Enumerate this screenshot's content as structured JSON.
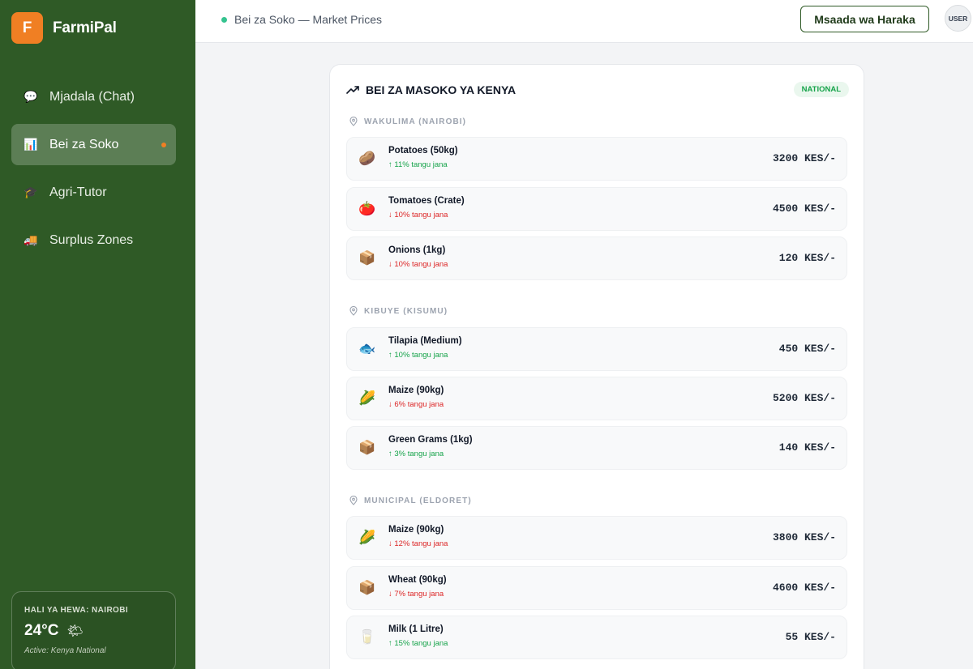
{
  "brand": {
    "logo_letter": "F",
    "name": "FarmiPal",
    "logo_color": "#f07f23"
  },
  "sidebar": {
    "items": [
      {
        "label": "Mjadala (Chat)",
        "icon": "chat-bubble-icon",
        "glyph": "💬",
        "active": false
      },
      {
        "label": "Bei za Soko",
        "icon": "bar-chart-icon",
        "glyph": "📊",
        "active": true
      },
      {
        "label": "Agri-Tutor",
        "icon": "graduation-cap-icon",
        "glyph": "🎓",
        "active": false
      },
      {
        "label": "Surplus Zones",
        "icon": "truck-icon",
        "glyph": "🚚",
        "active": false
      }
    ],
    "bg_color": "#2f5a26"
  },
  "weather": {
    "title": "HALI YA HEWA: NAIROBI",
    "temp": "24°C",
    "icon": "sun-behind-cloud-icon",
    "glyph": "🌤",
    "active_text": "Active: Kenya National"
  },
  "header": {
    "breadcrumb": "Bei za Soko — Market Prices",
    "help_button": "Msaada wa Haraka",
    "user_label": "USER"
  },
  "market": {
    "title": "BEI ZA MASOKO YA KENYA",
    "badge": "NATIONAL",
    "sections": [
      {
        "label": "WAKULIMA (NAIROBI)",
        "items": [
          {
            "name": "Potatoes (50kg)",
            "change": "↑ 11% tangu jana",
            "direction": "up",
            "price": "3200 KES/-",
            "icon": "potato-icon",
            "glyph": "🥔"
          },
          {
            "name": "Tomatoes (Crate)",
            "change": "↓ 10% tangu jana",
            "direction": "down",
            "price": "4500 KES/-",
            "icon": "tomato-icon",
            "glyph": "🍅"
          },
          {
            "name": "Onions (1kg)",
            "change": "↓ 10% tangu jana",
            "direction": "down",
            "price": "120 KES/-",
            "icon": "package-icon",
            "glyph": "📦"
          }
        ]
      },
      {
        "label": "KIBUYE (KISUMU)",
        "items": [
          {
            "name": "Tilapia (Medium)",
            "change": "↑ 10% tangu jana",
            "direction": "up",
            "price": "450 KES/-",
            "icon": "fish-icon",
            "glyph": "🐟"
          },
          {
            "name": "Maize (90kg)",
            "change": "↓ 6% tangu jana",
            "direction": "down",
            "price": "5200 KES/-",
            "icon": "corn-icon",
            "glyph": "🌽"
          },
          {
            "name": "Green Grams (1kg)",
            "change": "↑ 3% tangu jana",
            "direction": "up",
            "price": "140 KES/-",
            "icon": "package-icon",
            "glyph": "📦"
          }
        ]
      },
      {
        "label": "MUNICIPAL (ELDORET)",
        "items": [
          {
            "name": "Maize (90kg)",
            "change": "↓ 12% tangu jana",
            "direction": "down",
            "price": "3800 KES/-",
            "icon": "corn-icon",
            "glyph": "🌽"
          },
          {
            "name": "Wheat (90kg)",
            "change": "↓ 7% tangu jana",
            "direction": "down",
            "price": "4600 KES/-",
            "icon": "package-icon",
            "glyph": "📦"
          },
          {
            "name": "Milk (1 Litre)",
            "change": "↑ 15% tangu jana",
            "direction": "up",
            "price": "55 KES/-",
            "icon": "milk-glass-icon",
            "glyph": "🥛"
          }
        ]
      }
    ]
  },
  "colors": {
    "accent": "#f07f23",
    "up": "#16a34a",
    "down": "#dc2626",
    "header_dot": "#34c38f"
  }
}
